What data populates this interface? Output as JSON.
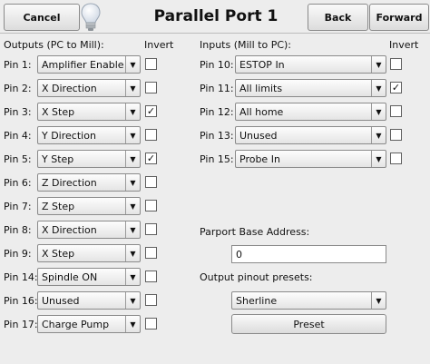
{
  "header": {
    "cancel_label": "Cancel",
    "title": "Parallel Port 1",
    "back_label": "Back",
    "forward_label": "Forward",
    "icon": "lightbulb-icon"
  },
  "outputs": {
    "heading": "Outputs (PC to Mill):",
    "invert_heading": "Invert",
    "rows": [
      {
        "label": "Pin 1:",
        "value": "Amplifier Enable",
        "invert": false
      },
      {
        "label": "Pin 2:",
        "value": "X Direction",
        "invert": false
      },
      {
        "label": "Pin 3:",
        "value": "X Step",
        "invert": true
      },
      {
        "label": "Pin 4:",
        "value": "Y Direction",
        "invert": false
      },
      {
        "label": "Pin 5:",
        "value": "Y Step",
        "invert": true
      },
      {
        "label": "Pin 6:",
        "value": "Z Direction",
        "invert": false
      },
      {
        "label": "Pin 7:",
        "value": "Z Step",
        "invert": false
      },
      {
        "label": "Pin 8:",
        "value": "X Direction",
        "invert": false
      },
      {
        "label": "Pin 9:",
        "value": "X Step",
        "invert": false
      },
      {
        "label": "Pin 14:",
        "value": "Spindle ON",
        "invert": false
      },
      {
        "label": "Pin 16:",
        "value": "Unused",
        "invert": false
      },
      {
        "label": "Pin 17:",
        "value": "Charge Pump",
        "invert": false
      }
    ]
  },
  "inputs": {
    "heading": "Inputs (Mill to PC):",
    "invert_heading": "Invert",
    "rows": [
      {
        "label": "Pin 10:",
        "value": "ESTOP In",
        "invert": false
      },
      {
        "label": "Pin 11:",
        "value": "All limits",
        "invert": true
      },
      {
        "label": "Pin 12:",
        "value": "All home",
        "invert": false
      },
      {
        "label": "Pin 13:",
        "value": "Unused",
        "invert": false
      },
      {
        "label": "Pin 15:",
        "value": "Probe In",
        "invert": false
      }
    ]
  },
  "parport": {
    "label": "Parport Base Address:",
    "value": "0"
  },
  "presets": {
    "label": "Output pinout presets:",
    "value": "Sherline",
    "button_label": "Preset"
  }
}
